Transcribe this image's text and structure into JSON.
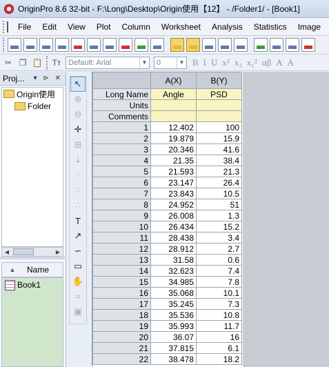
{
  "window": {
    "title": "OriginPro 8.6 32-bit - F:\\Long\\Desktop\\Origin使用【12】 - /Folder1/ - [Book1]"
  },
  "menu": {
    "items": [
      "File",
      "Edit",
      "View",
      "Plot",
      "Column",
      "Worksheet",
      "Analysis",
      "Statistics",
      "Image",
      "T"
    ]
  },
  "format_toolbar": {
    "font": "Default: Arial",
    "size": "0",
    "buttons": [
      "B",
      "I",
      "U",
      "x²",
      "x₂",
      "x₁²",
      "αβ",
      "A",
      "A"
    ]
  },
  "project_panel": {
    "title": "Proj...",
    "controls": "▾ ⊳ ✕",
    "tree": [
      {
        "label": "Origin使用",
        "level": 0
      },
      {
        "label": "Folder",
        "level": 1
      }
    ],
    "list_header": "Name",
    "list_items": [
      "Book1"
    ]
  },
  "worksheet": {
    "columns": [
      "A(X)",
      "B(Y)"
    ],
    "meta_rows": [
      {
        "label": "Long Name",
        "values": [
          "Angle",
          "PSD"
        ]
      },
      {
        "label": "Units",
        "values": [
          "",
          ""
        ]
      },
      {
        "label": "Comments",
        "values": [
          "",
          ""
        ]
      }
    ],
    "rows": [
      {
        "n": "1",
        "a": "12.402",
        "b": "100"
      },
      {
        "n": "2",
        "a": "19.879",
        "b": "15.9"
      },
      {
        "n": "3",
        "a": "20.346",
        "b": "41.6"
      },
      {
        "n": "4",
        "a": "21.35",
        "b": "38.4"
      },
      {
        "n": "5",
        "a": "21.593",
        "b": "21.3"
      },
      {
        "n": "6",
        "a": "23.147",
        "b": "26.4"
      },
      {
        "n": "7",
        "a": "23.843",
        "b": "10.5"
      },
      {
        "n": "8",
        "a": "24.952",
        "b": "51"
      },
      {
        "n": "9",
        "a": "26.008",
        "b": "1.3"
      },
      {
        "n": "10",
        "a": "26.434",
        "b": "15.2"
      },
      {
        "n": "11",
        "a": "28.438",
        "b": "3.4"
      },
      {
        "n": "12",
        "a": "28.912",
        "b": "2.7"
      },
      {
        "n": "13",
        "a": "31.58",
        "b": "0.6"
      },
      {
        "n": "14",
        "a": "32.623",
        "b": "7.4"
      },
      {
        "n": "15",
        "a": "34.985",
        "b": "7.8"
      },
      {
        "n": "16",
        "a": "35.068",
        "b": "10.1"
      },
      {
        "n": "17",
        "a": "35.245",
        "b": "7.3"
      },
      {
        "n": "18",
        "a": "35.536",
        "b": "10.8"
      },
      {
        "n": "19",
        "a": "35.993",
        "b": "11.7"
      },
      {
        "n": "20",
        "a": "36.07",
        "b": "16"
      },
      {
        "n": "21",
        "a": "37.815",
        "b": "6.1"
      },
      {
        "n": "22",
        "a": "38.478",
        "b": "18.2"
      }
    ]
  }
}
